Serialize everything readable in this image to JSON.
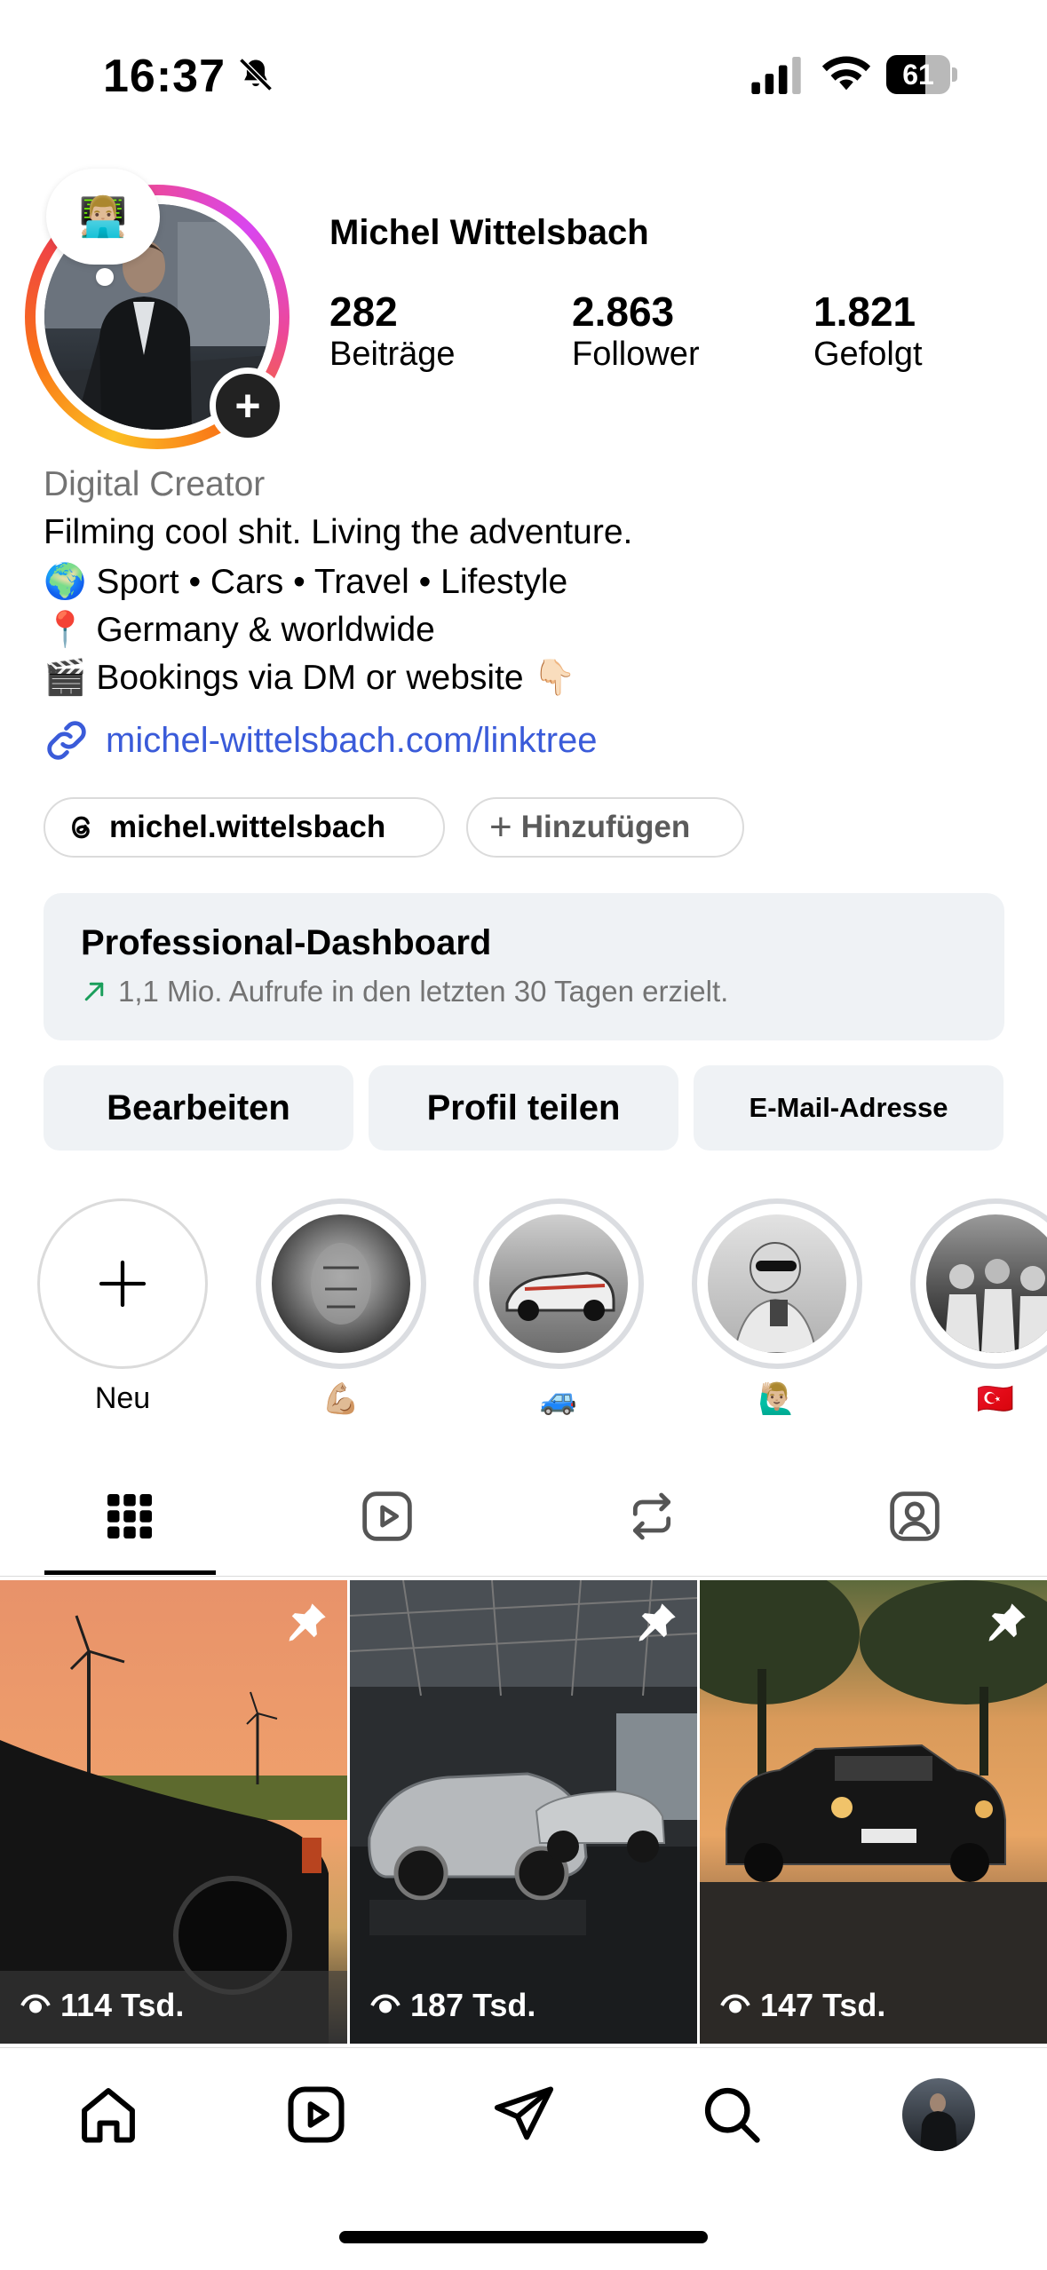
{
  "status_bar": {
    "time": "16:37",
    "battery": "61"
  },
  "profile": {
    "name": "Michel Wittelsbach",
    "note_emoji": "👨🏼‍💻",
    "stats": [
      {
        "value": "282",
        "label": "Beiträge"
      },
      {
        "value": "2.863",
        "label": "Follower"
      },
      {
        "value": "1.821",
        "label": "Gefolgt"
      }
    ],
    "category": "Digital Creator",
    "bio": [
      "Filming cool shit. Living the adventure.",
      "🌍 Sport • Cars • Travel • Lifestyle",
      "📍 Germany & worldwide",
      "🎬 Bookings via DM or website 👇🏻"
    ],
    "link": "michel-wittelsbach.com/linktree"
  },
  "pills": {
    "threads": "michel.wittelsbach",
    "add": "Hinzufügen"
  },
  "dashboard": {
    "title": "Professional-Dashboard",
    "subtitle": "1,1 Mio. Aufrufe in den letzten 30 Tagen erzielt."
  },
  "buttons": {
    "edit": "Bearbeiten",
    "share": "Profil teilen",
    "email": "E-Mail-Adresse"
  },
  "highlights": [
    {
      "label": "Neu"
    },
    {
      "label": "💪🏼"
    },
    {
      "label": "🚙"
    },
    {
      "label": "🙋🏼‍♂️"
    },
    {
      "label": "🇹🇷"
    }
  ],
  "posts": [
    {
      "views": "114 Tsd.",
      "pinned": true
    },
    {
      "views": "187 Tsd.",
      "pinned": true
    },
    {
      "views": "147 Tsd.",
      "pinned": true
    }
  ],
  "colors": {
    "link": "#3a5bd9",
    "muted": "#737373",
    "button_bg": "#eff2f5",
    "trend_green": "#1a9e5b"
  }
}
